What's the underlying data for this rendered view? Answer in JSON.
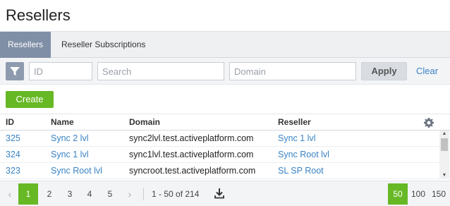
{
  "page": {
    "title": "Resellers"
  },
  "tabs": [
    {
      "label": "Resellers",
      "active": true
    },
    {
      "label": "Reseller Subscriptions",
      "active": false
    }
  ],
  "filters": {
    "id_placeholder": "ID",
    "search_placeholder": "Search",
    "domain_placeholder": "Domain",
    "apply_label": "Apply",
    "clear_label": "Clear"
  },
  "actions": {
    "create_label": "Create"
  },
  "table": {
    "columns": [
      "ID",
      "Name",
      "Domain",
      "Reseller"
    ],
    "rows": [
      {
        "id": "325",
        "name": "Sync 2 lvl",
        "domain": "sync2lvl.test.activeplatform.com",
        "reseller": "Sync 1 lvl"
      },
      {
        "id": "324",
        "name": "Sync 1 lvl",
        "domain": "sync1lvl.test.activeplatform.com",
        "reseller": "Sync Root lvl"
      },
      {
        "id": "323",
        "name": "Sync Root lvl",
        "domain": "syncroot.test.activeplatform.com",
        "reseller": "SL SP Root"
      }
    ]
  },
  "pagination": {
    "pages": [
      "1",
      "2",
      "3",
      "4",
      "5"
    ],
    "current_page": "1",
    "range_text": "1 - 50 of 214",
    "page_sizes": [
      "50",
      "100",
      "150"
    ],
    "current_size": "50"
  },
  "colors": {
    "accent_green": "#67b825",
    "link_blue": "#3a83c4",
    "active_tab": "#7f8fa6"
  },
  "icons": {
    "filter": "filter-icon",
    "settings": "gear-icon",
    "download": "download-icon"
  }
}
